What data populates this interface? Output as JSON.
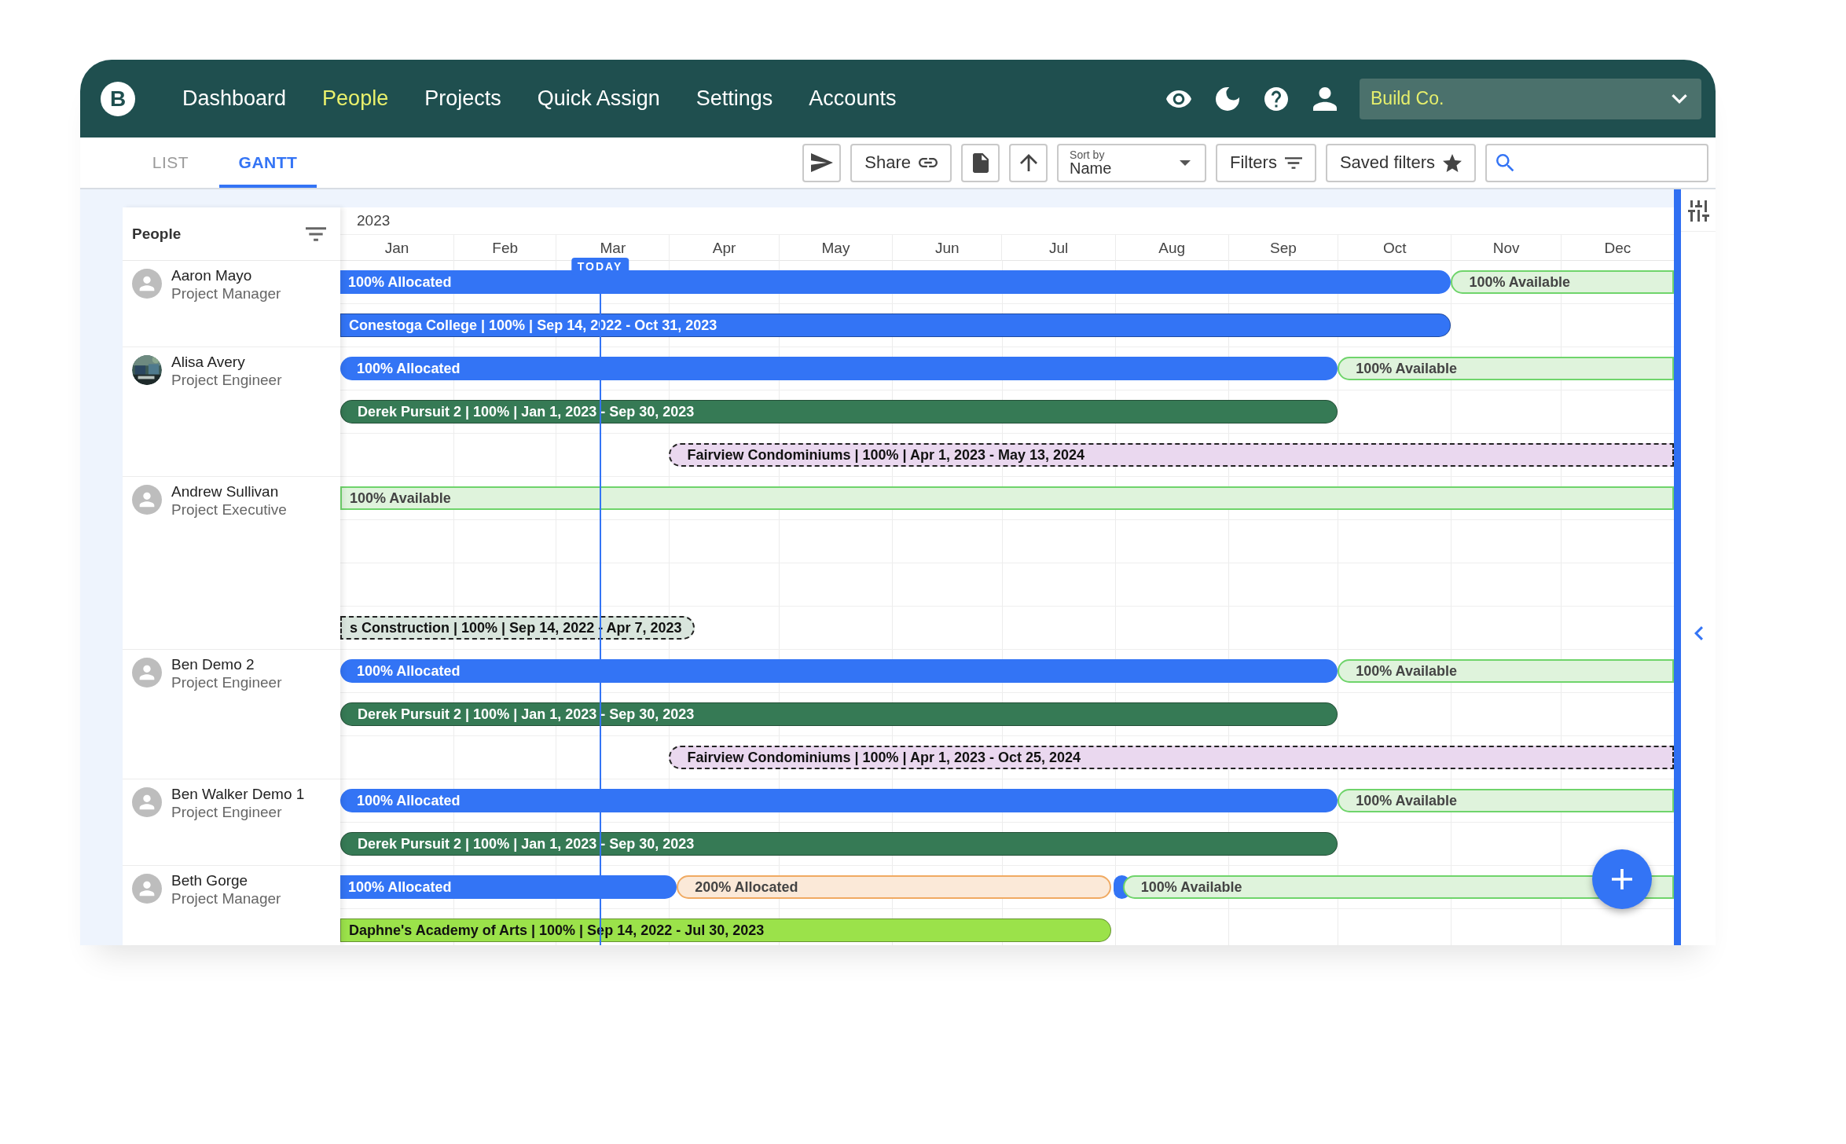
{
  "nav": {
    "logo": "B",
    "items": [
      {
        "label": "Dashboard",
        "selected": false
      },
      {
        "label": "People",
        "selected": true
      },
      {
        "label": "Projects",
        "selected": false
      },
      {
        "label": "Quick Assign",
        "selected": false
      },
      {
        "label": "Settings",
        "selected": false
      },
      {
        "label": "Accounts",
        "selected": false
      }
    ],
    "company": "Build Co."
  },
  "view_tabs": [
    {
      "label": "LIST",
      "selected": false
    },
    {
      "label": "GANTT",
      "selected": true
    }
  ],
  "toolbar": {
    "share": "Share",
    "sort": {
      "label": "Sort by",
      "value": "Name"
    },
    "filters": "Filters",
    "saved_filters": "Saved filters"
  },
  "people_panel": {
    "title": "People"
  },
  "gantt": {
    "year": "2023",
    "months": [
      "Jan",
      "Feb",
      "Mar",
      "Apr",
      "May",
      "Jun",
      "Jul",
      "Aug",
      "Sep",
      "Oct",
      "Nov",
      "Dec"
    ],
    "today": {
      "label": "TODAY"
    },
    "people": [
      {
        "name": "Aaron Mayo",
        "role": "Project Manager",
        "kind": "placeholder",
        "lanes": [
          {
            "bars": [
              {
                "kind": "allocated",
                "label": "100% Allocated"
              },
              {
                "kind": "available",
                "label": "100% Available"
              }
            ]
          },
          {
            "bars": [
              {
                "kind": "project",
                "color": "#3374f5",
                "label": "Conestoga College | 100% | Sep 14, 2022 - Oct 31, 2023"
              }
            ]
          }
        ]
      },
      {
        "name": "Alisa Avery",
        "role": "Project Engineer",
        "lanes": [
          {
            "bars": [
              {
                "kind": "allocated",
                "label": "100% Allocated"
              },
              {
                "kind": "available",
                "label": "100% Available"
              }
            ]
          },
          {
            "bars": [
              {
                "kind": "project",
                "color": "#367a55",
                "label": "Derek Pursuit 2 | 100% | Jan 1, 2023 - Sep 30, 2023"
              }
            ]
          },
          {
            "bars": [
              {
                "kind": "tentative",
                "color": "#ead8ef",
                "label": "Fairview Condominiums | 100% | Apr 1, 2023 - May 13, 2024"
              }
            ]
          }
        ]
      },
      {
        "name": "Andrew Sullivan",
        "role": "Project Executive",
        "kind": "placeholder",
        "lanes": [
          {
            "bars": [
              {
                "kind": "available",
                "label": "100% Available"
              }
            ]
          },
          {
            "bars": [
              {
                "kind": "tentative",
                "color": "#d9e5dd",
                "label": "s Construction | 100% | Sep 14, 2022 - Apr 7, 2023"
              }
            ]
          }
        ]
      },
      {
        "name": "Ben Demo 2",
        "role": "Project Engineer",
        "kind": "placeholder",
        "lanes": [
          {
            "bars": [
              {
                "kind": "allocated",
                "label": "100% Allocated"
              },
              {
                "kind": "available",
                "label": "100% Available"
              }
            ]
          },
          {
            "bars": [
              {
                "kind": "project",
                "color": "#367a55",
                "label": "Derek Pursuit 2 | 100% | Jan 1, 2023 - Sep 30, 2023"
              }
            ]
          },
          {
            "bars": [
              {
                "kind": "tentative",
                "color": "#ead8ef",
                "label": "Fairview Condominiums | 100% | Apr 1, 2023 - Oct 25, 2024"
              }
            ]
          }
        ]
      },
      {
        "name": "Ben Walker Demo 1",
        "role": "Project Engineer",
        "kind": "placeholder",
        "lanes": [
          {
            "bars": [
              {
                "kind": "allocated",
                "label": "100% Allocated"
              },
              {
                "kind": "available",
                "label": "100% Available"
              }
            ]
          },
          {
            "bars": [
              {
                "kind": "project",
                "color": "#367a55",
                "label": "Derek Pursuit 2 | 100% | Jan 1, 2023 - Sep 30, 2023"
              }
            ]
          }
        ]
      },
      {
        "name": "Beth Gorge",
        "role": "Project Manager",
        "kind": "placeholder",
        "lanes": [
          {
            "bars": [
              {
                "kind": "allocated",
                "label": "100% Allocated"
              },
              {
                "kind": "overallocated",
                "label": "200% Allocated"
              },
              {
                "kind": "allocated"
              },
              {
                "kind": "available",
                "label": "100% Available"
              }
            ]
          },
          {
            "bars": [
              {
                "kind": "project",
                "color": "#9be24a",
                "label": "Daphne's Academy of Arts | 100% | Sep 14, 2022 - Jul 30, 2023"
              }
            ]
          }
        ]
      }
    ]
  }
}
